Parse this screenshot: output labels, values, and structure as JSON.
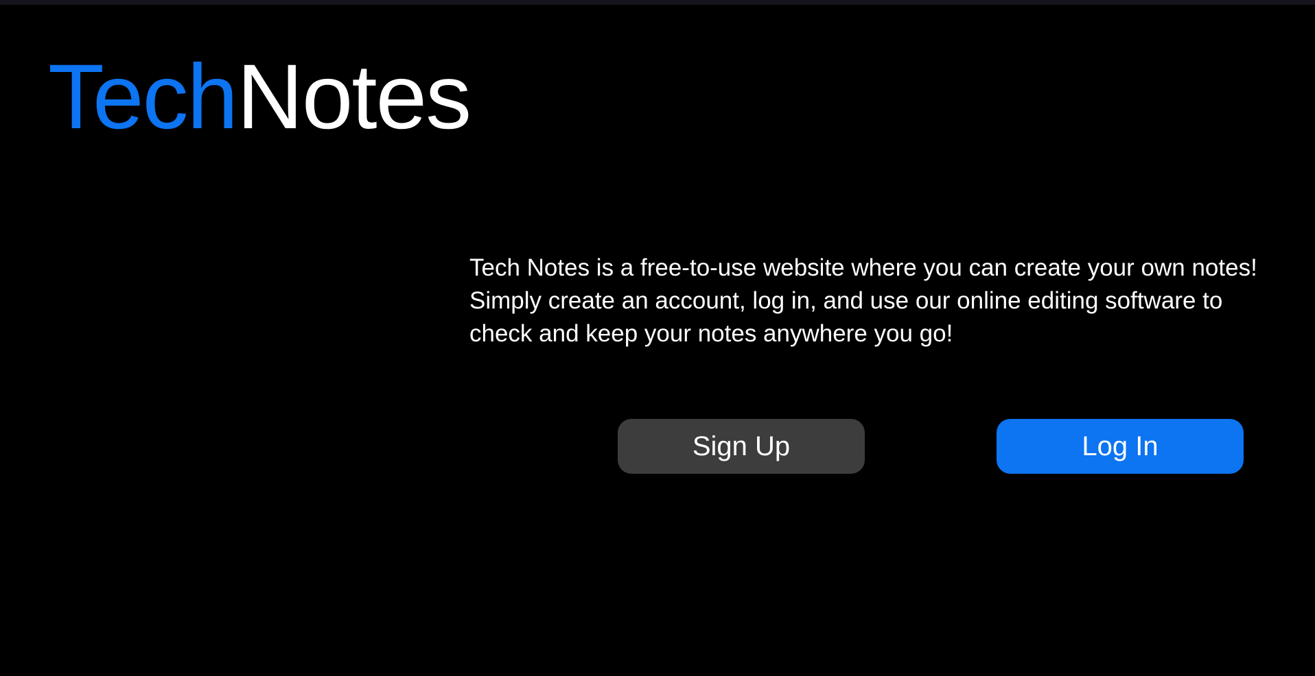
{
  "header": {
    "logo_part_1": "Tech",
    "logo_part_2": "Notes"
  },
  "main": {
    "intro_lines": [
      "Tech Notes is a free-to-use website where you can create your own notes!",
      "Simply create an account, log in, and use our online editing software to",
      "check and keep your notes anywhere you go!"
    ]
  },
  "actions": {
    "signup_label": "Sign Up",
    "login_label": "Log In"
  },
  "colors": {
    "background": "#000000",
    "accent": "#0d74f2",
    "secondary_button": "#3d3d3d",
    "text": "#ffffff"
  }
}
